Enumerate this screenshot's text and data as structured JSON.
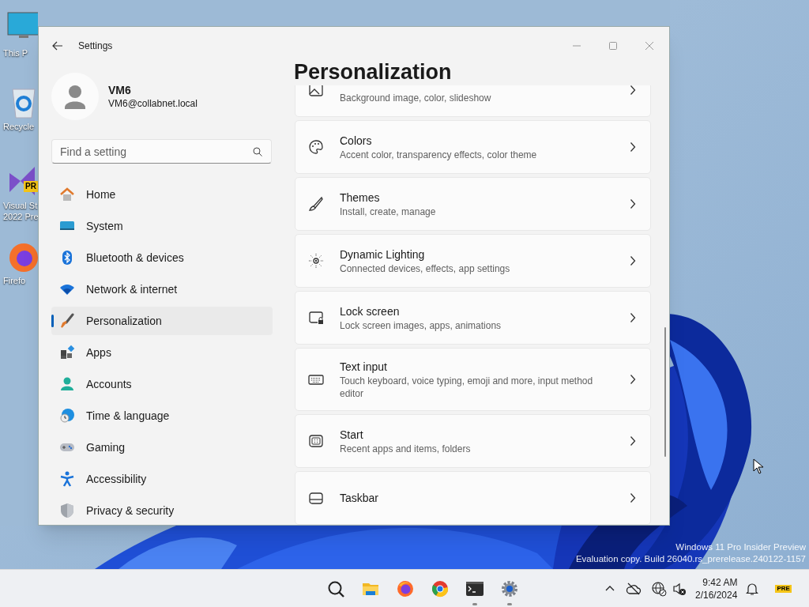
{
  "desktop_icons": [
    {
      "label_lines": [
        "This P"
      ]
    },
    {
      "label_lines": [
        "Recycle"
      ]
    },
    {
      "label_lines": [
        "Visual St",
        "2022 Pre"
      ],
      "badge": "PR"
    },
    {
      "label_lines": [
        "Firefo"
      ]
    }
  ],
  "window": {
    "title": "Settings"
  },
  "profile": {
    "name": "VM6",
    "email": "VM6@collabnet.local"
  },
  "search": {
    "placeholder": "Find a setting"
  },
  "sidebar": {
    "items": [
      {
        "label": "Home",
        "selected": false
      },
      {
        "label": "System",
        "selected": false
      },
      {
        "label": "Bluetooth & devices",
        "selected": false
      },
      {
        "label": "Network & internet",
        "selected": false
      },
      {
        "label": "Personalization",
        "selected": true
      },
      {
        "label": "Apps",
        "selected": false
      },
      {
        "label": "Accounts",
        "selected": false
      },
      {
        "label": "Time & language",
        "selected": false
      },
      {
        "label": "Gaming",
        "selected": false
      },
      {
        "label": "Accessibility",
        "selected": false
      },
      {
        "label": "Privacy & security",
        "selected": false
      }
    ]
  },
  "page": {
    "title": "Personalization",
    "cards": [
      {
        "subtitle": "Background image, color, slideshow"
      },
      {
        "title": "Colors",
        "subtitle": "Accent color, transparency effects, color theme"
      },
      {
        "title": "Themes",
        "subtitle": "Install, create, manage"
      },
      {
        "title": "Dynamic Lighting",
        "subtitle": "Connected devices, effects, app settings"
      },
      {
        "title": "Lock screen",
        "subtitle": "Lock screen images, apps, animations"
      },
      {
        "title": "Text input",
        "subtitle": "Touch keyboard, voice typing, emoji and more, input method editor"
      },
      {
        "title": "Start",
        "subtitle": "Recent apps and items, folders"
      },
      {
        "title": "Taskbar"
      }
    ]
  },
  "watermark_lines": [
    "Windows 11 Pro Insider Preview",
    "Evaluation copy. Build 26040.rs_prerelease.240122-1157"
  ],
  "taskbar": {
    "apps": [
      {
        "running": false
      },
      {
        "running": false
      },
      {
        "running": false
      },
      {
        "running": false
      },
      {
        "running": true
      },
      {
        "running": true
      }
    ],
    "time": "9:42 AM",
    "date": "2/16/2024",
    "badge": "PRE"
  }
}
